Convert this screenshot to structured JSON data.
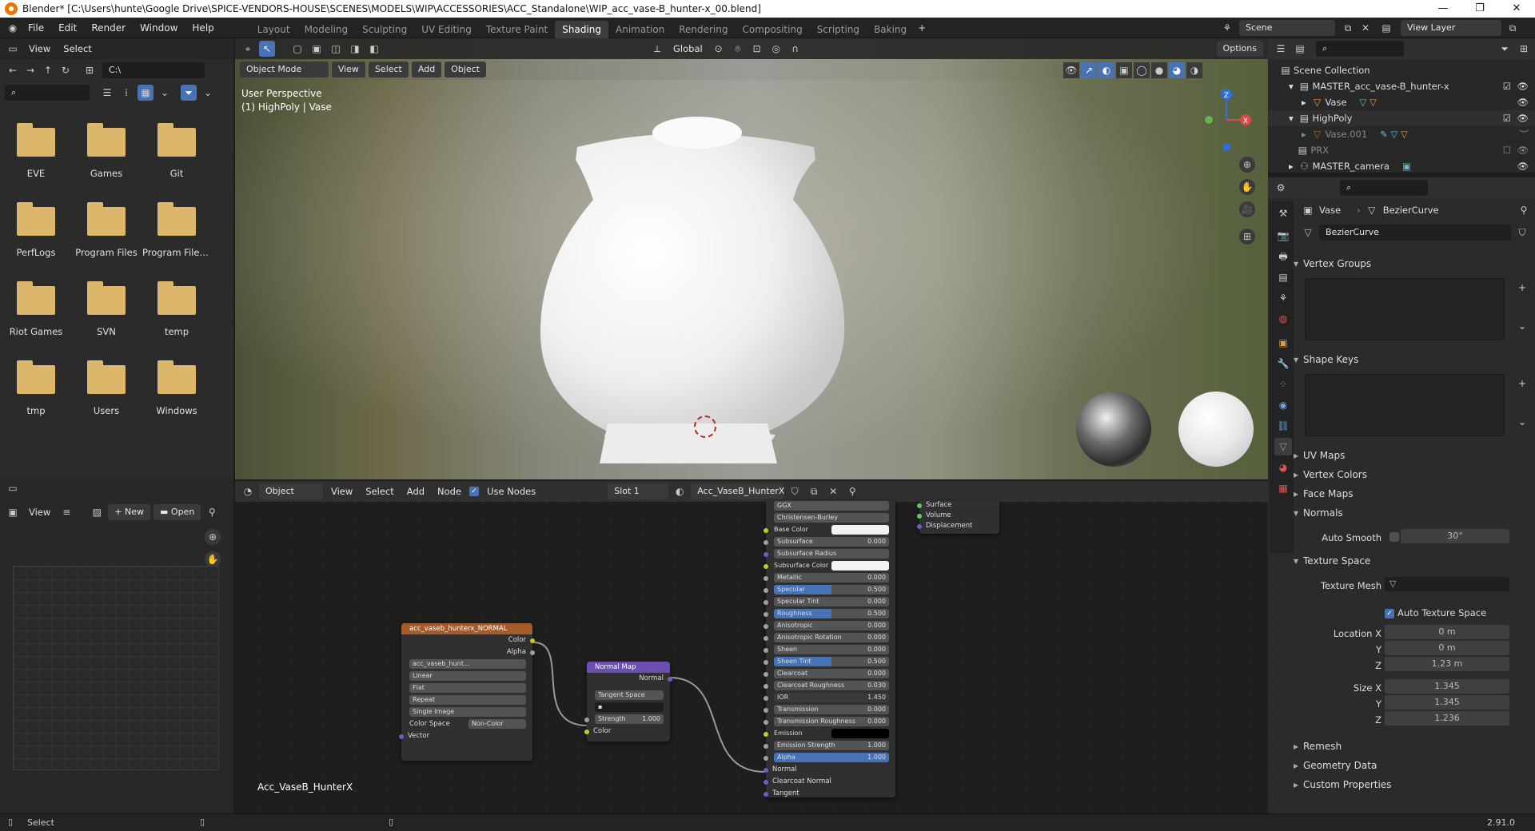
{
  "window": {
    "title": "Blender* [C:\\Users\\hunte\\Google Drive\\SPICE-VENDORS-HOUSE\\SCENES\\MODELS\\WIP\\ACCESSORIES\\ACC_Standalone\\WIP_acc_vase-B_hunter-x_00.blend]"
  },
  "menu": [
    "File",
    "Edit",
    "Render",
    "Window",
    "Help"
  ],
  "workspaces": [
    "Layout",
    "Modeling",
    "Sculpting",
    "UV Editing",
    "Texture Paint",
    "Shading",
    "Animation",
    "Rendering",
    "Compositing",
    "Scripting",
    "Baking"
  ],
  "active_workspace": "Shading",
  "scene": "Scene",
  "view_layer": "View Layer",
  "file_browser": {
    "menu": [
      "View",
      "Select"
    ],
    "path": "C:\\",
    "folders": [
      "EVE",
      "Games",
      "Git",
      "PerfLogs",
      "Program Files",
      "Program Files...",
      "Riot Games",
      "SVN",
      "temp",
      "tmp",
      "Users",
      "Windows"
    ]
  },
  "image_editor": {
    "view": "View",
    "new": "New",
    "open": "Open"
  },
  "viewport": {
    "mode": "Object Mode",
    "menu": [
      "View",
      "Select",
      "Add",
      "Object"
    ],
    "orientation": "Global",
    "options": "Options",
    "overlay_line1": "User Perspective",
    "overlay_line2": "(1) HighPoly | Vase",
    "gizmo": {
      "z": "Z",
      "x": "X"
    }
  },
  "node_editor": {
    "object": "Object",
    "menu": [
      "View",
      "Select",
      "Add",
      "Node"
    ],
    "use_nodes": "Use Nodes",
    "slot": "Slot 1",
    "material": "Acc_VaseB_HunterX",
    "material_label": "Acc_VaseB_HunterX",
    "image_node": {
      "title": "acc_vaseb_hunterx_NORMAL",
      "out_color": "Color",
      "out_alpha": "Alpha",
      "image": "acc_vaseb_hunt...",
      "interp": "Linear",
      "proj": "Flat",
      "ext": "Repeat",
      "src": "Single Image",
      "cs_label": "Color Space",
      "cs_value": "Non-Color",
      "vector": "Vector"
    },
    "normal_map": {
      "title": "Normal Map",
      "out": "Normal",
      "space": "Tangent Space",
      "strength_label": "Strength",
      "strength": "1.000",
      "color": "Color"
    },
    "bsdf": {
      "dist": "GGX",
      "sss": "Christensen-Burley",
      "rows": [
        [
          "Base Color",
          ""
        ],
        [
          "Subsurface",
          "0.000"
        ],
        [
          "Subsurface Radius",
          ""
        ],
        [
          "Subsurface Color",
          ""
        ],
        [
          "Metallic",
          "0.000"
        ],
        [
          "Specular",
          "0.500"
        ],
        [
          "Specular Tint",
          "0.000"
        ],
        [
          "Roughness",
          "0.500"
        ],
        [
          "Anisotropic",
          "0.000"
        ],
        [
          "Anisotropic Rotation",
          "0.000"
        ],
        [
          "Sheen",
          "0.000"
        ],
        [
          "Sheen Tint",
          "0.500"
        ],
        [
          "Clearcoat",
          "0.000"
        ],
        [
          "Clearcoat Roughness",
          "0.030"
        ],
        [
          "IOR",
          "1.450"
        ],
        [
          "Transmission",
          "0.000"
        ],
        [
          "Transmission Roughness",
          "0.000"
        ],
        [
          "Emission",
          ""
        ],
        [
          "Emission Strength",
          "1.000"
        ],
        [
          "Alpha",
          "1.000"
        ]
      ],
      "inputs": [
        "Normal",
        "Clearcoat Normal",
        "Tangent"
      ]
    },
    "output": [
      "Surface",
      "Volume",
      "Displacement"
    ]
  },
  "outliner": {
    "root": "Scene Collection",
    "items": [
      "MASTER_acc_vase-B_hunter-x",
      "Vase",
      "HighPoly",
      "Vase.001",
      "PRX",
      "MASTER_camera"
    ]
  },
  "properties": {
    "object": "Vase",
    "data": "BezierCurve",
    "datablock": "BezierCurve",
    "sections": {
      "vertex_groups": "Vertex Groups",
      "shape_keys": "Shape Keys",
      "uv_maps": "UV Maps",
      "vertex_colors": "Vertex Colors",
      "face_maps": "Face Maps",
      "normals": "Normals",
      "texture_space": "Texture Space",
      "remesh": "Remesh",
      "geometry_data": "Geometry Data",
      "custom_properties": "Custom Properties"
    },
    "auto_smooth": "Auto Smooth",
    "angle": "30°",
    "texture_mesh": "Texture Mesh",
    "auto_texture_space": "Auto Texture Space",
    "location_label": "Location X",
    "y_label": "Y",
    "z_label": "Z",
    "size_label": "Size X",
    "location": [
      "0 m",
      "0 m",
      "1.23 m"
    ],
    "size": [
      "1.345",
      "1.345",
      "1.236"
    ]
  },
  "status": {
    "select": "Select",
    "version": "2.91.0"
  }
}
